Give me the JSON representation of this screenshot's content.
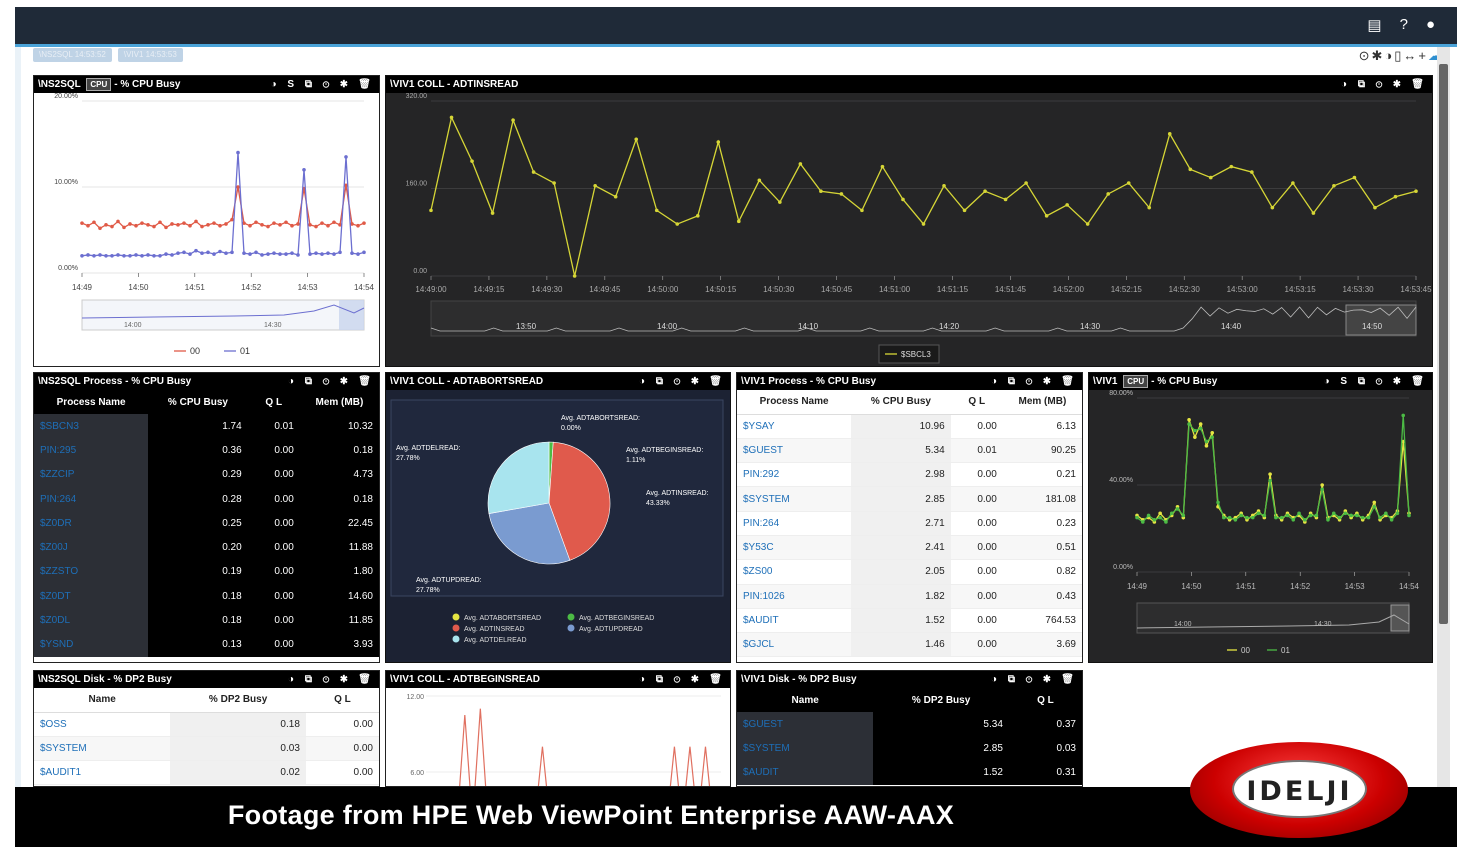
{
  "caption": "Footage from HPE Web ViewPoint Enterprise AAW-AAX",
  "logo_text": "IDELJI",
  "tabs": [
    "\\NS2SQL 14:53:52",
    "\\VIV1 14:53:53"
  ],
  "topbar_icons": [
    "monitor-icon",
    "help-icon",
    "user-icon"
  ],
  "panels": {
    "p1": {
      "title": "\\NS2SQL",
      "badge": "CPU",
      "title2": "- % CPU Busy",
      "icons": "◑ S ⧉ ⊙ ✱ 🗑",
      "legend": [
        "00",
        "01"
      ]
    },
    "p2": {
      "title": "\\VIV1 COLL - ADTINSREAD",
      "icons": "◑ ⧉ ⊙ ✱ 🗑",
      "legend": "$SBCL3"
    },
    "p3": {
      "title": "\\NS2SQL Process - % CPU Busy",
      "icons": "◑ ⧉ ⊙ ✱ 🗑"
    },
    "p4": {
      "title": "\\VIV1 COLL - ADTABORTSREAD",
      "icons": "◑ ⧉ ⊙ ✱ 🗑"
    },
    "p5": {
      "title": "\\VIV1 Process - % CPU Busy",
      "icons": "◑ ⧉ ⊙ ✱ 🗑"
    },
    "p6": {
      "title": "\\VIV1",
      "badge": "CPU",
      "title2": "- % CPU Busy",
      "icons": "◑ S ⧉ ⊙ ✱ 🗑",
      "legend": [
        "00",
        "01"
      ]
    },
    "p7": {
      "title": "\\NS2SQL Disk - % DP2 Busy",
      "icons": "◑ ⧉ ⊙ ✱ 🗑"
    },
    "p8": {
      "title": "\\VIV1 COLL - ADTBEGINSREAD",
      "icons": "◑ ⧉ ⊙ ✱ 🗑"
    },
    "p9": {
      "title": "\\VIV1 Disk - % DP2 Busy",
      "icons": "◑ ⧉ ⊙ ✱ 🗑"
    }
  },
  "proc_headers": [
    "Process Name",
    "% CPU Busy",
    "Q L",
    "Mem (MB)"
  ],
  "ns2sql_processes": [
    [
      "$SBCN3",
      "1.74",
      "0.01",
      "10.32"
    ],
    [
      "PIN:295",
      "0.36",
      "0.00",
      "0.18"
    ],
    [
      "$ZZCIP",
      "0.29",
      "0.00",
      "4.73"
    ],
    [
      "PIN:264",
      "0.28",
      "0.00",
      "0.18"
    ],
    [
      "$Z0DR",
      "0.25",
      "0.00",
      "22.45"
    ],
    [
      "$Z00J",
      "0.20",
      "0.00",
      "11.88"
    ],
    [
      "$ZZSTO",
      "0.19",
      "0.00",
      "1.80"
    ],
    [
      "$Z0DT",
      "0.18",
      "0.00",
      "14.60"
    ],
    [
      "$Z0DL",
      "0.18",
      "0.00",
      "11.85"
    ],
    [
      "$YSND",
      "0.13",
      "0.00",
      "3.93"
    ]
  ],
  "viv1_processes": [
    [
      "$YSAY",
      "10.96",
      "0.00",
      "6.13"
    ],
    [
      "$GUEST",
      "5.34",
      "0.01",
      "90.25"
    ],
    [
      "PIN:292",
      "2.98",
      "0.00",
      "0.21"
    ],
    [
      "$SYSTEM",
      "2.85",
      "0.00",
      "181.08"
    ],
    [
      "PIN:264",
      "2.71",
      "0.00",
      "0.23"
    ],
    [
      "$Y53C",
      "2.41",
      "0.00",
      "0.51"
    ],
    [
      "$ZS00",
      "2.05",
      "0.00",
      "0.82"
    ],
    [
      "PIN:1026",
      "1.82",
      "0.00",
      "0.43"
    ],
    [
      "$AUDIT",
      "1.52",
      "0.00",
      "764.53"
    ],
    [
      "$GJCL",
      "1.46",
      "0.00",
      "3.69"
    ]
  ],
  "disk_headers": [
    "Name",
    "% DP2 Busy",
    "Q L"
  ],
  "ns2sql_disks": [
    [
      "$OSS",
      "0.18",
      "0.00"
    ],
    [
      "$SYSTEM",
      "0.03",
      "0.00"
    ],
    [
      "$AUDIT1",
      "0.02",
      "0.00"
    ]
  ],
  "viv1_disks": [
    [
      "$GUEST",
      "5.34",
      "0.37"
    ],
    [
      "$SYSTEM",
      "2.85",
      "0.03"
    ],
    [
      "$AUDIT",
      "1.52",
      "0.31"
    ]
  ],
  "chart_data": [
    {
      "type": "line",
      "panel": "p1",
      "yticks": [
        "0.00%",
        "10.00%",
        "20.00%"
      ],
      "ylim": [
        0,
        20
      ],
      "x": [
        "14:49",
        "14:50",
        "14:51",
        "14:52",
        "14:53",
        "14:54"
      ],
      "series": [
        {
          "name": "00",
          "color": "#e05a47",
          "values": [
            5.8,
            5.5,
            5.9,
            5.2,
            5.6,
            5.4,
            6.0,
            5.3,
            5.7,
            5.5,
            5.8,
            5.6,
            5.4,
            5.9,
            5.3,
            5.7,
            5.6,
            5.8,
            5.5,
            6.0,
            5.4,
            5.6,
            5.8,
            5.5,
            5.7,
            6.2,
            10.0,
            5.8,
            5.5,
            5.9,
            5.6,
            5.4,
            5.8,
            5.6,
            5.9,
            5.5,
            5.7,
            9.8,
            5.6,
            5.4,
            5.8,
            5.5,
            5.9,
            5.6,
            10.2,
            5.7,
            5.5,
            5.8
          ]
        },
        {
          "name": "01",
          "color": "#6c6fd0",
          "values": [
            2.0,
            2.1,
            2.0,
            2.1,
            2.0,
            2.0,
            2.1,
            2.0,
            2.0,
            2.1,
            2.0,
            2.1,
            2.0,
            2.0,
            2.2,
            2.1,
            2.3,
            2.4,
            2.2,
            2.6,
            2.3,
            2.4,
            2.2,
            2.5,
            2.3,
            2.4,
            14.0,
            2.3,
            2.2,
            2.4,
            2.1,
            2.2,
            2.3,
            2.2,
            2.2,
            2.3,
            2.1,
            12.0,
            2.2,
            2.3,
            2.2,
            2.3,
            2.2,
            2.4,
            13.5,
            2.3,
            2.2,
            2.4
          ]
        }
      ],
      "navigator": [
        "14:00",
        "14:30"
      ]
    },
    {
      "type": "line",
      "panel": "p2",
      "yticks": [
        "0.00",
        "160.00",
        "320.00"
      ],
      "ylim": [
        0,
        320
      ],
      "x": [
        "14:49:00",
        "14:49:15",
        "14:49:30",
        "14:49:45",
        "14:50:00",
        "14:50:15",
        "14:50:30",
        "14:50:45",
        "14:51:00",
        "14:51:15",
        "14:51:45",
        "14:52:00",
        "14:52:15",
        "14:52:30",
        "14:53:00",
        "14:53:15",
        "14:53:30",
        "14:53:45"
      ],
      "series": [
        {
          "name": "$SBCL3",
          "color": "#d6d636",
          "values": [
            120,
            290,
            210,
            115,
            285,
            190,
            170,
            0,
            165,
            145,
            250,
            120,
            95,
            110,
            245,
            100,
            175,
            135,
            205,
            155,
            150,
            120,
            200,
            140,
            95,
            165,
            120,
            155,
            140,
            170,
            110,
            130,
            95,
            150,
            170,
            125,
            260,
            195,
            180,
            200,
            190,
            125,
            170,
            115,
            165,
            180,
            125,
            145,
            155
          ]
        }
      ],
      "navigator": [
        "13:50",
        "14:00",
        "14:10",
        "14:20",
        "14:30",
        "14:40",
        "14:50"
      ]
    },
    {
      "type": "pie",
      "panel": "p4",
      "slices": [
        {
          "label": "Avg. ADTABORTSREAD:",
          "value": "0.00%",
          "pct": 0.0,
          "color": "#e5e542"
        },
        {
          "label": "Avg. ADTBEGINSREAD:",
          "value": "1.11%",
          "pct": 1.11,
          "color": "#4cbb45"
        },
        {
          "label": "Avg. ADTINSREAD:",
          "value": "43.33%",
          "pct": 43.33,
          "color": "#e05a4c"
        },
        {
          "label": "Avg. ADTUPDREAD:",
          "value": "27.78%",
          "pct": 27.78,
          "color": "#7a9bd0"
        },
        {
          "label": "Avg. ADTDELREAD:",
          "value": "27.78%",
          "pct": 27.78,
          "color": "#a8e4ee"
        }
      ],
      "legend": [
        "Avg. ADTABORTSREAD",
        "Avg. ADTBEGINSREAD",
        "Avg. ADTINSREAD",
        "Avg. ADTUPDREAD",
        "Avg. ADTDELREAD"
      ]
    },
    {
      "type": "line",
      "panel": "p6",
      "yticks": [
        "0.00%",
        "40.00%",
        "80.00%"
      ],
      "ylim": [
        0,
        80
      ],
      "x": [
        "14:49",
        "14:50",
        "14:51",
        "14:52",
        "14:53",
        "14:54"
      ],
      "series": [
        {
          "name": "00",
          "color": "#e5e542",
          "values": [
            26,
            24,
            25,
            23,
            27,
            24,
            26,
            30,
            25,
            70,
            62,
            68,
            58,
            64,
            30,
            26,
            24,
            25,
            27,
            24,
            26,
            28,
            25,
            45,
            26,
            24,
            27,
            25,
            26,
            23,
            27,
            25,
            40,
            25,
            26,
            24,
            28,
            25,
            27,
            24,
            26,
            32,
            24,
            26,
            25,
            28,
            60,
            27
          ]
        },
        {
          "name": "01",
          "color": "#4cbb45",
          "values": [
            25,
            23,
            26,
            24,
            25,
            23,
            27,
            29,
            26,
            68,
            65,
            66,
            60,
            62,
            32,
            25,
            25,
            24,
            26,
            25,
            25,
            27,
            26,
            42,
            25,
            25,
            26,
            24,
            27,
            24,
            26,
            26,
            38,
            24,
            27,
            25,
            27,
            26,
            26,
            25,
            25,
            30,
            25,
            27,
            24,
            27,
            72,
            26
          ]
        }
      ],
      "navigator": [
        "14:00",
        "14:30"
      ]
    },
    {
      "type": "line",
      "panel": "p8",
      "yticks": [
        "6.00",
        "12.00"
      ],
      "ylim": [
        0,
        12
      ],
      "series": [
        {
          "name": "",
          "color": "#e07060",
          "values": [
            2,
            2,
            2,
            2,
            2,
            10.5,
            2,
            11,
            2,
            2,
            2,
            2,
            2,
            2,
            2,
            8,
            2,
            2,
            2,
            2,
            2,
            2,
            2,
            2,
            2,
            2,
            2,
            2,
            2,
            2,
            2,
            2,
            8,
            2,
            8,
            2,
            8,
            2,
            2
          ]
        }
      ]
    }
  ]
}
